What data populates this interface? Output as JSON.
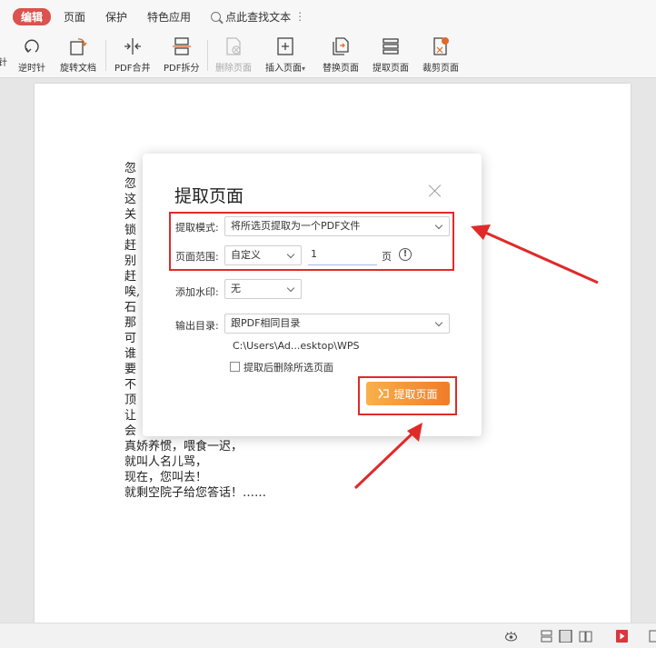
{
  "menu": {
    "items": [
      "编辑",
      "页面",
      "保护",
      "特色应用"
    ],
    "search_label": "点此查找文本",
    "more_glyph": "⋮"
  },
  "toolbar": {
    "partial_label": "针",
    "items": [
      {
        "label": "逆时针",
        "icon": "rotate-ccw-icon"
      },
      {
        "label": "旋转文档",
        "icon": "rotate-doc-icon"
      },
      {
        "label": "PDF合并",
        "icon": "merge-icon"
      },
      {
        "label": "PDF拆分",
        "icon": "split-icon"
      },
      {
        "label": "删除页面",
        "icon": "delete-page-icon",
        "disabled": true
      },
      {
        "label": "插入页面",
        "icon": "insert-page-icon",
        "dropdown": "▾"
      },
      {
        "label": "替换页面",
        "icon": "replace-page-icon"
      },
      {
        "label": "提取页面",
        "icon": "extract-page-icon"
      },
      {
        "label": "裁剪页面",
        "icon": "crop-page-icon"
      }
    ]
  },
  "document": {
    "lines": [
      "忽",
      "忽",
      "这",
      "关",
      "锁",
      "赶",
      "别",
      "赶",
      "唉,",
      "石",
      "那",
      "可",
      "谁",
      "要",
      "不",
      "顶",
      "让",
      "会",
      "真娇养惯，喂食一迟，",
      "就叫人名儿骂，",
      "现在，您叫去！",
      "就剩空院子给您答话！……"
    ]
  },
  "dialog": {
    "title": "提取页面",
    "mode_label": "提取模式:",
    "mode_value": "将所选页提取为一个PDF文件",
    "range_label": "页面范围:",
    "range_value": "自定义",
    "range_input": "1",
    "range_unit": "页",
    "info_glyph": "!",
    "watermark_label": "添加水印:",
    "watermark_value": "无",
    "output_label": "输出目录:",
    "output_value": "跟PDF相同目录",
    "output_path": "C:\\Users\\Ad...esktop\\WPS",
    "delete_checkbox_label": "提取后删除所选页面",
    "delete_checked": false,
    "submit_label": "提取页面"
  },
  "colors": {
    "accent_red": "#d9534f",
    "annotation_red": "#e02a2a",
    "button_orange_start": "#f8b14a",
    "button_orange_end": "#f07c2a"
  }
}
